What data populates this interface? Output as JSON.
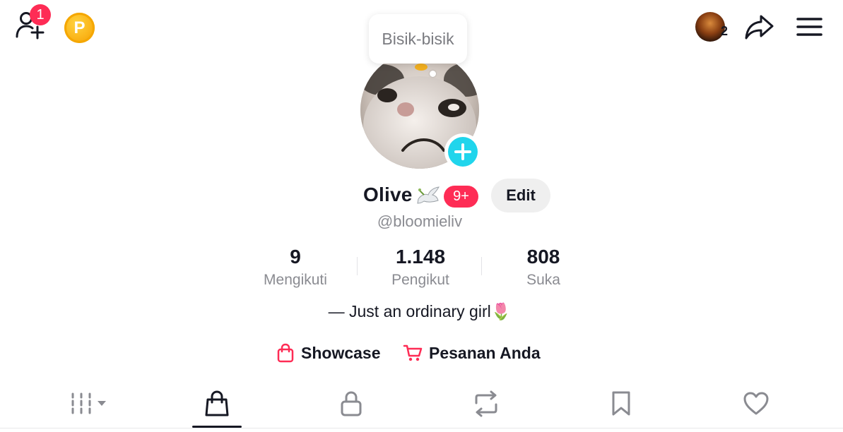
{
  "header": {
    "add_friend_badge": "1",
    "coin_letter": "P",
    "friend_notification_count": "2",
    "icons": [
      "add-friend-icon",
      "coin-icon",
      "share-icon",
      "menu-icon"
    ]
  },
  "tooltip": {
    "text": "Bisik-bisik"
  },
  "profile": {
    "name": "Olive",
    "name_emoji": "dove",
    "badge": "9+",
    "edit_label": "Edit",
    "handle": "@bloomieliv",
    "bio": "— Just an ordinary girl🌷"
  },
  "stats": [
    {
      "value": "9",
      "label": "Mengikuti"
    },
    {
      "value": "1.148",
      "label": "Pengikut"
    },
    {
      "value": "808",
      "label": "Suka"
    }
  ],
  "links": {
    "showcase": "Showcase",
    "orders": "Pesanan Anda"
  },
  "tabs": [
    {
      "name": "videos-grid",
      "icon": "grid-icon",
      "active": false
    },
    {
      "name": "shop",
      "icon": "shopping-bag-icon",
      "active": true
    },
    {
      "name": "private",
      "icon": "lock-icon",
      "active": false
    },
    {
      "name": "reposts",
      "icon": "repost-icon",
      "active": false
    },
    {
      "name": "favorites",
      "icon": "bookmark-icon",
      "active": false
    },
    {
      "name": "liked",
      "icon": "heart-icon",
      "active": false
    }
  ],
  "colors": {
    "accent": "#fe2c55",
    "add_button": "#20d5ec",
    "coin": "#fbb61b",
    "text_primary": "#161823",
    "text_secondary": "#8a8b91",
    "edit_bg": "#efefef"
  }
}
